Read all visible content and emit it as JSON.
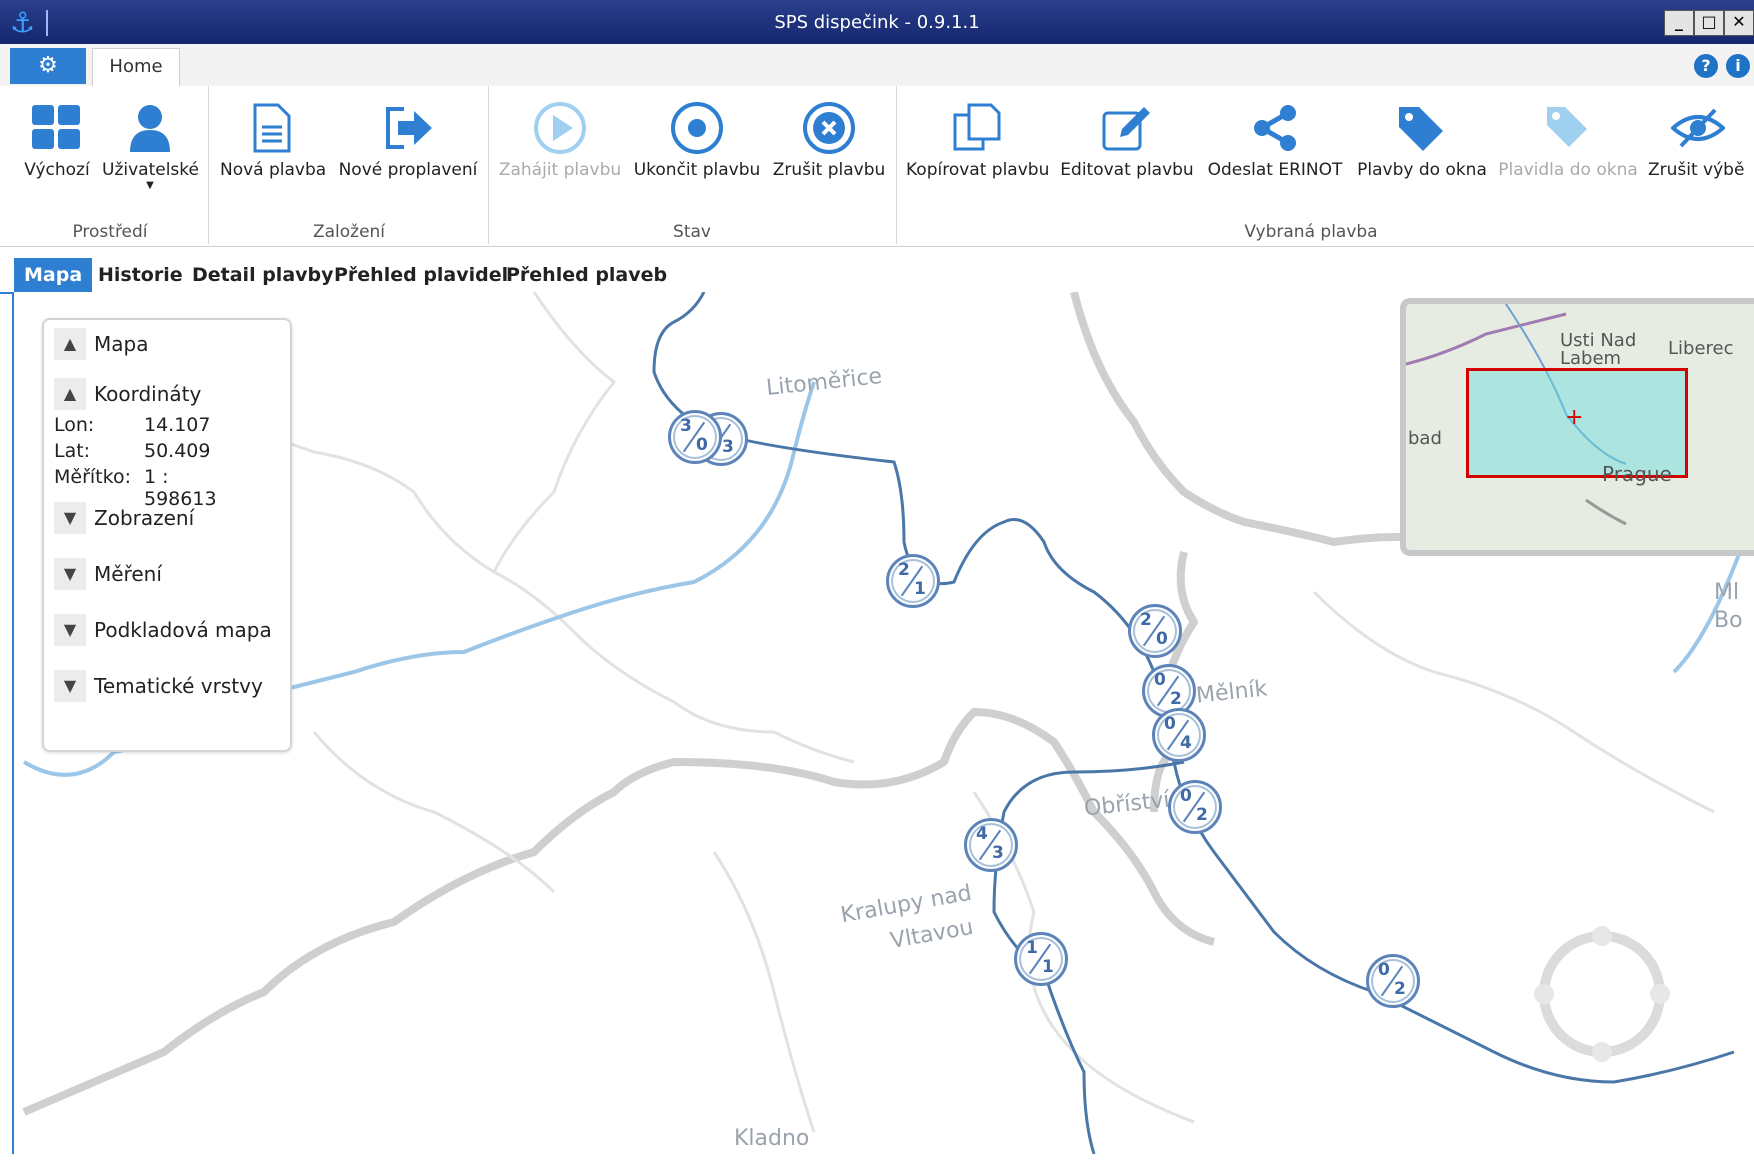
{
  "window": {
    "title": "SPS dispečink - 0.9.1.1",
    "minimize": "_",
    "maximize": "□",
    "close": "✕"
  },
  "ribbon_tabs": {
    "settings_icon": "⚙",
    "home": "Home"
  },
  "ribbon": {
    "groups": {
      "prostredi": "Prostředí",
      "zalozeni": "Založení",
      "stav": "Stav",
      "vybrana": "Vybraná plavba"
    },
    "buttons": {
      "vychozi": "Výchozí",
      "uzivatelske": "Uživatelské",
      "nova_plavba": "Nová plavba",
      "nove_proplaveni": "Nové proplavení",
      "zahajit": "Zahájit plavbu",
      "ukoncit": "Ukončit plavbu",
      "zrusit": "Zrušit plavbu",
      "kopirovat": "Kopírovat plavbu",
      "editovat": "Editovat plavbu",
      "odeslat": "Odeslat ERINOT",
      "plavby_okna": "Plavby do okna",
      "plavidla_okna": "Plavidla do okna",
      "zrusit_vyber": "Zrušit výbě"
    }
  },
  "view_tabs": [
    "Mapa",
    "Historie",
    "Detail plavby",
    "Přehled plavidel",
    "Přehled plaveb"
  ],
  "panel": {
    "mapa": "Mapa",
    "koordinaty": "Koordináty",
    "lon_label": "Lon:",
    "lon": "14.107",
    "lat_label": "Lat:",
    "lat": "50.409",
    "scale_label": "Měřítko:",
    "scale": "1 : 598613",
    "zobrazeni": "Zobrazení",
    "mereni": "Měření",
    "podkladova": "Podkladová mapa",
    "tematicke": "Tematické vrstvy"
  },
  "overview_map": {
    "l1": "Usti Nad",
    "l2": "Labem",
    "l3": "Liberec",
    "l4": "bad",
    "l5": "Prague"
  },
  "map_labels": {
    "litomerice": "Litoměřice",
    "melnik": "Mělník",
    "obristvi": "Obříství",
    "kralupy1": "Kralupy nad",
    "kralupy2": "Vltavou",
    "kladno": "Kladno",
    "mlada1": "Ml",
    "mlada2": "Bo"
  },
  "markers": [
    {
      "a": "3",
      "b": "0"
    },
    {
      "a": "",
      "b": "3"
    },
    {
      "a": "2",
      "b": "1"
    },
    {
      "a": "2",
      "b": "0"
    },
    {
      "a": "0",
      "b": "2"
    },
    {
      "a": "0",
      "b": "4"
    },
    {
      "a": "0",
      "b": "2"
    },
    {
      "a": "4",
      "b": "3"
    },
    {
      "a": "1",
      "b": "1"
    },
    {
      "a": "0",
      "b": "2"
    }
  ],
  "colors": {
    "accent": "#2e7fd1",
    "titlebar": "#14266e",
    "marker": "#5c84b8",
    "extent": "#d40000"
  }
}
